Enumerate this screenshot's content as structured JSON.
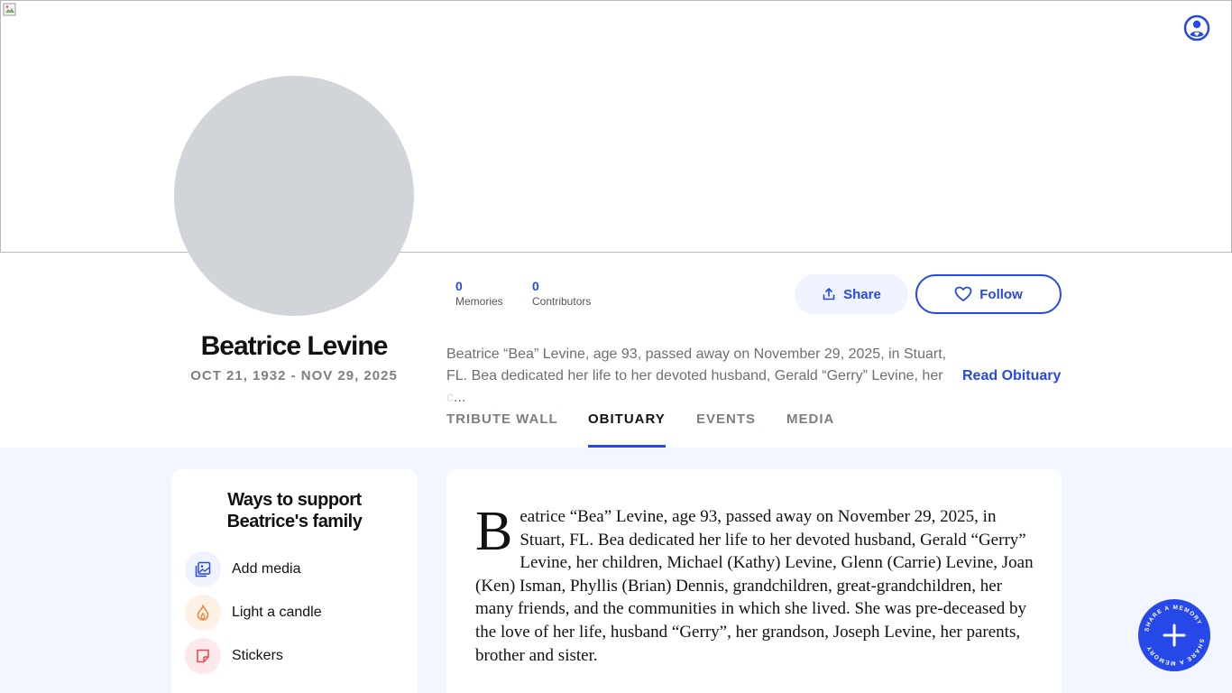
{
  "profile": {
    "name": "Beatrice Levine",
    "dates": "OCT 21, 1932 - NOV 29, 2025"
  },
  "stats": {
    "memories_count": "0",
    "memories_label": "Memories",
    "contributors_count": "0",
    "contributors_label": "Contributors"
  },
  "actions": {
    "share_label": "Share",
    "follow_label": "Follow"
  },
  "excerpt": {
    "text": "Beatrice “Bea” Levine, age 93, passed away on November 29, 2025, in Stuart, FL. Bea dedicated her life to her devoted husband, Gerald “Gerry” Levine, her ",
    "faded": "c",
    "ellipsis": "...",
    "read_more": "Read Obituary"
  },
  "tabs": [
    {
      "label": "TRIBUTE WALL"
    },
    {
      "label": "OBITUARY"
    },
    {
      "label": "EVENTS"
    },
    {
      "label": "MEDIA"
    }
  ],
  "active_tab": "OBITUARY",
  "support": {
    "title_line1": "Ways to support",
    "title_line2": "Beatrice's family",
    "items": [
      {
        "label": "Add media",
        "icon": "image-icon"
      },
      {
        "label": "Light a candle",
        "icon": "flame-icon"
      },
      {
        "label": "Stickers",
        "icon": "sticker-icon"
      }
    ]
  },
  "obituary": {
    "dropcap": "B",
    "body": "eatrice “Bea” Levine, age 93, passed away on November 29, 2025, in Stuart, FL. Bea dedicated her life to her devoted husband, Gerald “Gerry” Levine, her children, Michael (Kathy) Levine, Glenn (Carrie) Levine, Joan (Ken) Isman, Phyllis (Brian) Dennis, grandchildren, great-grandchildren, her many friends, and the communities in which she lived. She was pre-deceased by the love of her life, husband “Gerry”, her grandson, Joseph Levine, her parents, brother and sister."
  },
  "fab": {
    "ring_text": "SHARE A MEMORY",
    "icon": "plus-icon"
  },
  "colors": {
    "accent": "#2748e8",
    "avatar_placeholder": "#d1d5da",
    "content_background": "#f2f6fe",
    "share_background": "#eef3fd",
    "candle": "#e8873a",
    "sticker": "#e5484d"
  }
}
